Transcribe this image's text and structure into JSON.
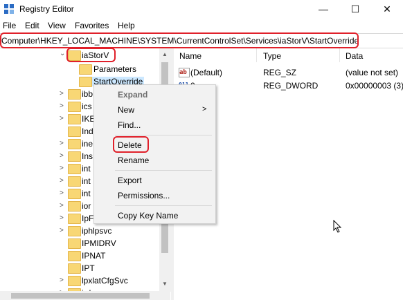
{
  "window": {
    "title": "Registry Editor",
    "minimize_glyph": "—",
    "maximize_glyph": "☐",
    "close_glyph": "✕",
    "icon": "registry-icon"
  },
  "menubar": [
    "File",
    "Edit",
    "View",
    "Favorites",
    "Help"
  ],
  "address": {
    "path": "Computer\\HKEY_LOCAL_MACHINE\\SYSTEM\\CurrentControlSet\\Services\\iaStorV\\StartOverride"
  },
  "tree": {
    "items": [
      {
        "label": "iaStorV",
        "expander": "⌄",
        "level": 0,
        "state": "expanded"
      },
      {
        "label": "Parameters",
        "expander": "",
        "level": 1
      },
      {
        "label": "StartOverride",
        "expander": "",
        "level": 1,
        "selected": true
      },
      {
        "label": "ibb",
        "expander": ">",
        "level": 0
      },
      {
        "label": "ics",
        "expander": ">",
        "level": 0
      },
      {
        "label": "IKE",
        "expander": ">",
        "level": 0
      },
      {
        "label": "Ind",
        "expander": "",
        "level": 0
      },
      {
        "label": "ine",
        "expander": ">",
        "level": 0
      },
      {
        "label": "Ins",
        "expander": ">",
        "level": 0
      },
      {
        "label": "int",
        "expander": ">",
        "level": 0
      },
      {
        "label": "int",
        "expander": ">",
        "level": 0
      },
      {
        "label": "int",
        "expander": ">",
        "level": 0
      },
      {
        "label": "ior",
        "expander": ">",
        "level": 0
      },
      {
        "label": "IpF",
        "expander": ">",
        "level": 0
      },
      {
        "label": "iphlpsvc",
        "expander": ">",
        "level": 0
      },
      {
        "label": "IPMIDRV",
        "expander": "",
        "level": 0
      },
      {
        "label": "IPNAT",
        "expander": "",
        "level": 0
      },
      {
        "label": "IPT",
        "expander": "",
        "level": 0
      },
      {
        "label": "lpxlatCfgSvc",
        "expander": ">",
        "level": 0
      },
      {
        "label": "irda",
        "expander": ">",
        "level": 0
      }
    ]
  },
  "values_pane": {
    "headers": {
      "name": "Name",
      "type": "Type",
      "data": "Data"
    },
    "rows": [
      {
        "icon": "ab",
        "name": "(Default)",
        "type": "REG_SZ",
        "data": "(value not set)"
      },
      {
        "icon": "011",
        "name": "0",
        "type": "REG_DWORD",
        "data": "0x00000003 (3)"
      }
    ]
  },
  "context_menu": {
    "items": [
      {
        "label": "Expand",
        "disabled": true
      },
      {
        "label": "New",
        "submenu": ">"
      },
      {
        "label": "Find..."
      },
      {
        "label": "Delete",
        "highlighted": true
      },
      {
        "label": "Rename"
      },
      {
        "label": "Export"
      },
      {
        "label": "Permissions..."
      },
      {
        "label": "Copy Key Name"
      }
    ]
  },
  "colors": {
    "annotation_red": "#e0202a",
    "folder_yellow": "#f8d775",
    "selection_blue": "#cce8ff"
  }
}
